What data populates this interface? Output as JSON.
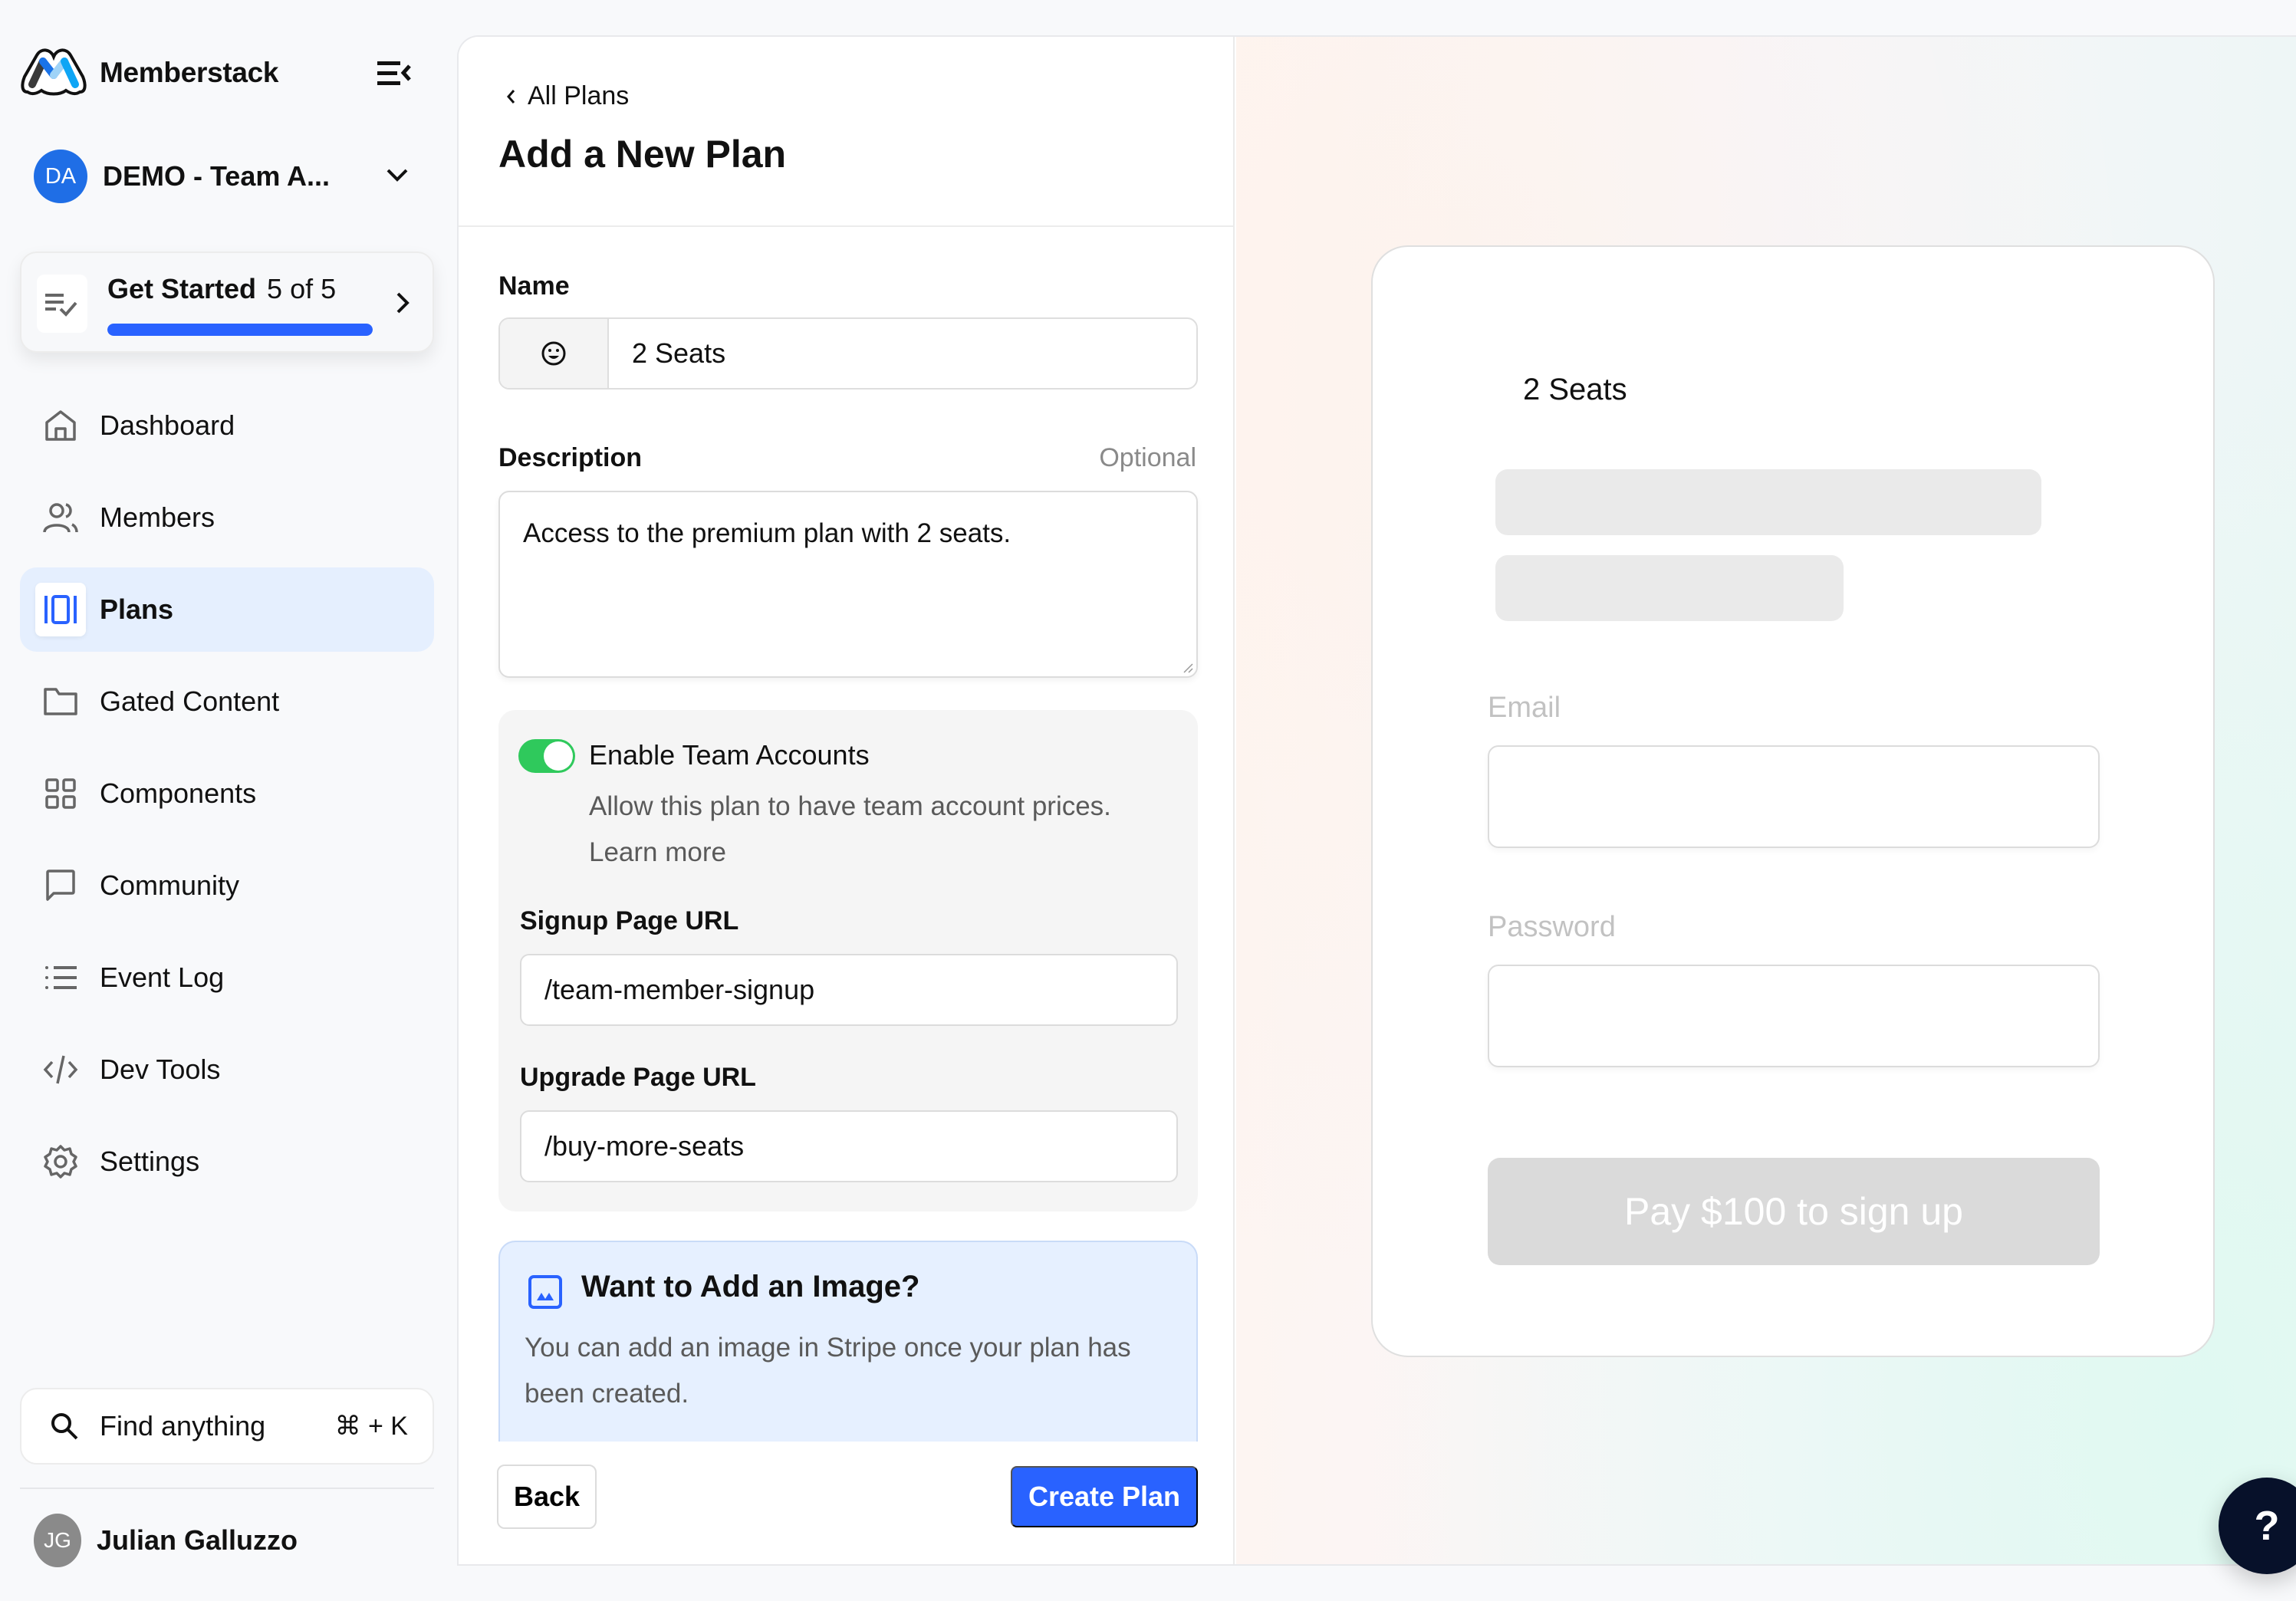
{
  "brand": {
    "name": "Memberstack"
  },
  "workspace": {
    "initials": "DA",
    "name": "DEMO - Team A...",
    "avatar_color": "#1f6ee6"
  },
  "get_started": {
    "title": "Get Started",
    "count": "5 of 5",
    "progress": 1.0,
    "accent": "#2962ff"
  },
  "nav": {
    "items": [
      {
        "label": "Dashboard",
        "icon": "home-icon",
        "active": false
      },
      {
        "label": "Members",
        "icon": "users-icon",
        "active": false
      },
      {
        "label": "Plans",
        "icon": "plans-icon",
        "active": true
      },
      {
        "label": "Gated Content",
        "icon": "folder-icon",
        "active": false
      },
      {
        "label": "Components",
        "icon": "grid-icon",
        "active": false
      },
      {
        "label": "Community",
        "icon": "chat-icon",
        "active": false
      },
      {
        "label": "Event Log",
        "icon": "list-icon",
        "active": false
      },
      {
        "label": "Dev Tools",
        "icon": "code-icon",
        "active": false
      },
      {
        "label": "Settings",
        "icon": "gear-icon",
        "active": false
      }
    ]
  },
  "search": {
    "label": "Find anything",
    "shortcut": "⌘ + K"
  },
  "user": {
    "initials": "JG",
    "name": "Julian Galluzzo"
  },
  "form": {
    "back_link": "All Plans",
    "title": "Add a New Plan",
    "name_label": "Name",
    "name_value": "2 Seats",
    "description_label": "Description",
    "description_optional": "Optional",
    "description_value": "Access to the premium plan with 2 seats.",
    "team": {
      "toggle_on": true,
      "title": "Enable Team Accounts",
      "description": "Allow this plan to have team account prices.",
      "learn_more": "Learn more",
      "signup_label": "Signup Page URL",
      "signup_value": "/team-member-signup",
      "upgrade_label": "Upgrade Page URL",
      "upgrade_value": "/buy-more-seats"
    },
    "image_tip": {
      "title": "Want to Add an Image?",
      "text": "You can add an image in Stripe once your plan has been created."
    },
    "back_button": "Back",
    "create_button": "Create Plan"
  },
  "preview": {
    "plan_name": "2 Seats",
    "email_label": "Email",
    "password_label": "Password",
    "pay_button": "Pay $100 to sign up"
  },
  "help": {
    "label": "?"
  }
}
